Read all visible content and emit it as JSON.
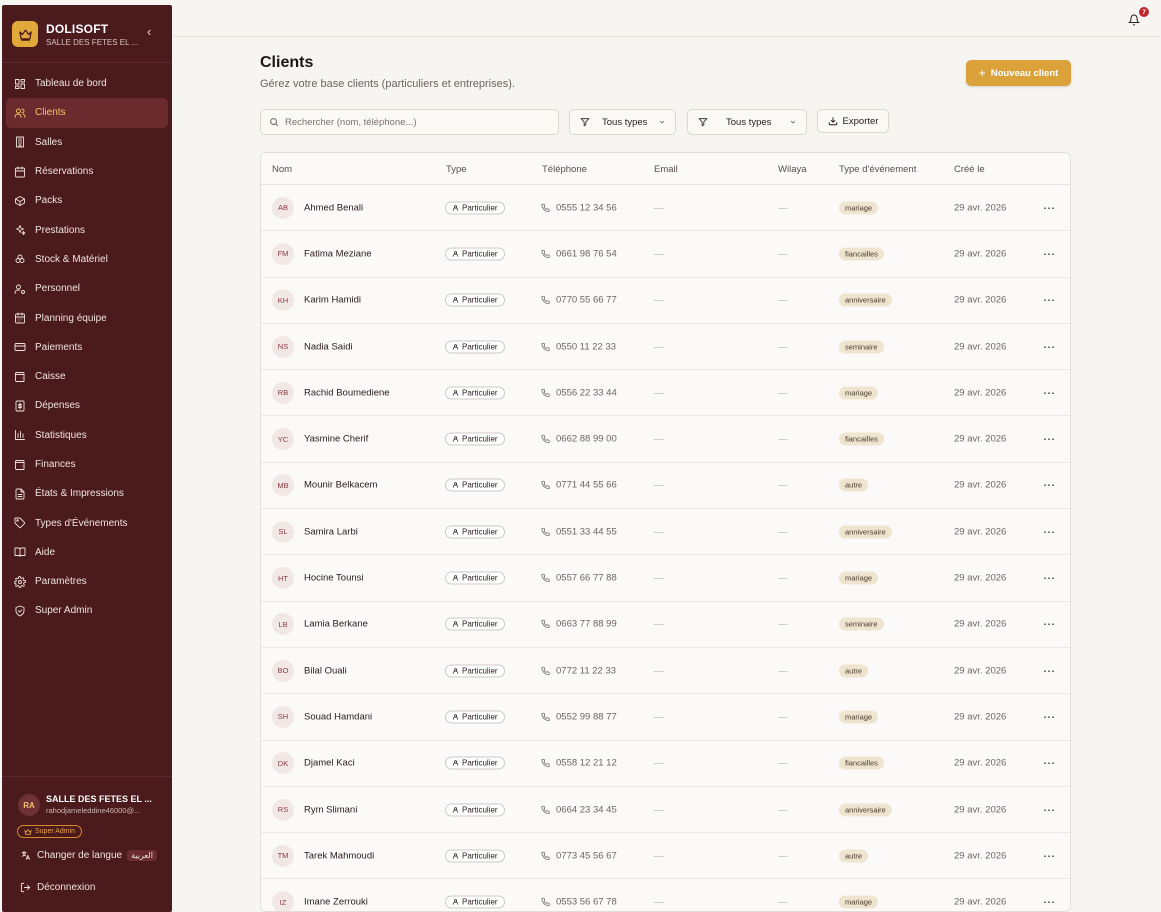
{
  "brand": {
    "title": "DOLISOFT",
    "subtitle": "SALLE DES FETES EL ...",
    "collapse": "‹"
  },
  "sidebar": {
    "items": [
      {
        "label": "Tableau de bord",
        "icon": "dashboard-icon"
      },
      {
        "label": "Clients",
        "icon": "users-icon",
        "active": true
      },
      {
        "label": "Salles",
        "icon": "building-icon"
      },
      {
        "label": "Réservations",
        "icon": "calendar-icon"
      },
      {
        "label": "Packs",
        "icon": "box-icon"
      },
      {
        "label": "Prestations",
        "icon": "sparkles-icon"
      },
      {
        "label": "Stock & Matériel",
        "icon": "boxes-icon"
      },
      {
        "label": "Personnel",
        "icon": "user-cog-icon"
      },
      {
        "label": "Planning équipe",
        "icon": "calendar-days-icon"
      },
      {
        "label": "Paiements",
        "icon": "credit-card-icon"
      },
      {
        "label": "Caisse",
        "icon": "wallet-icon"
      },
      {
        "label": "Dépenses",
        "icon": "receipt-icon"
      },
      {
        "label": "Statistiques",
        "icon": "bar-chart-icon"
      },
      {
        "label": "Finances",
        "icon": "wallet-icon"
      },
      {
        "label": "États & Impressions",
        "icon": "file-text-icon"
      },
      {
        "label": "Types d'Événements",
        "icon": "tag-icon"
      },
      {
        "label": "Aide",
        "icon": "book-icon"
      },
      {
        "label": "Paramètres",
        "icon": "settings-icon"
      },
      {
        "label": "Super Admin",
        "icon": "shield-icon"
      }
    ],
    "user": {
      "initials": "RA",
      "name": "SALLE DES FETES EL ...",
      "email": "rahodjameleddine46000@...",
      "role": "Super Admin"
    },
    "language": {
      "label": "Changer de langue",
      "tag": "العربية"
    },
    "logout": "Déconnexion"
  },
  "topbar": {
    "notifications": "7"
  },
  "header": {
    "title": "Clients",
    "subtitle": "Gérez votre base clients (particuliers et entreprises).",
    "new_button": "Nouveau client"
  },
  "toolbar": {
    "search_placeholder": "Rechercher (nom, téléphone...)",
    "filter1": "Tous types",
    "filter2": "Tous types",
    "export": "Exporter"
  },
  "table": {
    "columns": [
      "Nom",
      "Type",
      "Téléphone",
      "Email",
      "Wilaya",
      "Type d'événement",
      "Créé le"
    ],
    "rows": [
      {
        "initials": "AB",
        "name": "Ahmed Benali",
        "type": "Particulier",
        "phone": "0555 12 34 56",
        "email": "—",
        "wilaya": "—",
        "event": "mariage",
        "created": "29 avr. 2026"
      },
      {
        "initials": "FM",
        "name": "Fatima Meziane",
        "type": "Particulier",
        "phone": "0661 98 76 54",
        "email": "—",
        "wilaya": "—",
        "event": "fiancailles",
        "created": "29 avr. 2026"
      },
      {
        "initials": "KH",
        "name": "Karim Hamidi",
        "type": "Particulier",
        "phone": "0770 55 66 77",
        "email": "—",
        "wilaya": "—",
        "event": "anniversaire",
        "created": "29 avr. 2026"
      },
      {
        "initials": "NS",
        "name": "Nadia Saidi",
        "type": "Particulier",
        "phone": "0550 11 22 33",
        "email": "—",
        "wilaya": "—",
        "event": "seminaire",
        "created": "29 avr. 2026"
      },
      {
        "initials": "RB",
        "name": "Rachid Boumediene",
        "type": "Particulier",
        "phone": "0556 22 33 44",
        "email": "—",
        "wilaya": "—",
        "event": "mariage",
        "created": "29 avr. 2026"
      },
      {
        "initials": "YC",
        "name": "Yasmine Cherif",
        "type": "Particulier",
        "phone": "0662 88 99 00",
        "email": "—",
        "wilaya": "—",
        "event": "fiancailles",
        "created": "29 avr. 2026"
      },
      {
        "initials": "MB",
        "name": "Mounir Belkacem",
        "type": "Particulier",
        "phone": "0771 44 55 66",
        "email": "—",
        "wilaya": "—",
        "event": "autre",
        "created": "29 avr. 2026"
      },
      {
        "initials": "SL",
        "name": "Samira Larbi",
        "type": "Particulier",
        "phone": "0551 33 44 55",
        "email": "—",
        "wilaya": "—",
        "event": "anniversaire",
        "created": "29 avr. 2026"
      },
      {
        "initials": "HT",
        "name": "Hocine Tounsi",
        "type": "Particulier",
        "phone": "0557 66 77 88",
        "email": "—",
        "wilaya": "—",
        "event": "mariage",
        "created": "29 avr. 2026"
      },
      {
        "initials": "LB",
        "name": "Lamia Berkane",
        "type": "Particulier",
        "phone": "0663 77 88 99",
        "email": "—",
        "wilaya": "—",
        "event": "seminaire",
        "created": "29 avr. 2026"
      },
      {
        "initials": "BO",
        "name": "Bilal Ouali",
        "type": "Particulier",
        "phone": "0772 11 22 33",
        "email": "—",
        "wilaya": "—",
        "event": "autre",
        "created": "29 avr. 2026"
      },
      {
        "initials": "SH",
        "name": "Souad Hamdani",
        "type": "Particulier",
        "phone": "0552 99 88 77",
        "email": "—",
        "wilaya": "—",
        "event": "mariage",
        "created": "29 avr. 2026"
      },
      {
        "initials": "DK",
        "name": "Djamel Kaci",
        "type": "Particulier",
        "phone": "0558 12 21 12",
        "email": "—",
        "wilaya": "—",
        "event": "fiancailles",
        "created": "29 avr. 2026"
      },
      {
        "initials": "RS",
        "name": "Rym Slimani",
        "type": "Particulier",
        "phone": "0664 23 34 45",
        "email": "—",
        "wilaya": "—",
        "event": "anniversaire",
        "created": "29 avr. 2026"
      },
      {
        "initials": "TM",
        "name": "Tarek Mahmoudi",
        "type": "Particulier",
        "phone": "0773 45 56 67",
        "email": "—",
        "wilaya": "—",
        "event": "autre",
        "created": "29 avr. 2026"
      },
      {
        "initials": "IZ",
        "name": "Imane Zerrouki",
        "type": "Particulier",
        "phone": "0553 56 67 78",
        "email": "—",
        "wilaya": "—",
        "event": "mariage",
        "created": "29 avr. 2026"
      }
    ]
  },
  "colors": {
    "sidebar": "#4a1a1d",
    "accent": "#dca23a",
    "active_text": "#f4c36a"
  }
}
